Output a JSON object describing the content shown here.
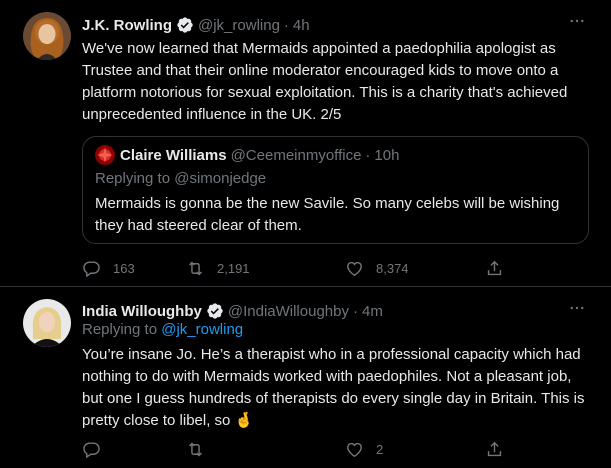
{
  "colors": {
    "background": "#000000",
    "text": "#e7e9ea",
    "secondary": "#71767b",
    "border": "#2f3336",
    "accent": "#1d9bf0"
  },
  "tweet1": {
    "name": "J.K. Rowling",
    "verified": true,
    "handle": "@jk_rowling",
    "dot": "·",
    "time": "4h",
    "text": "We've now learned that Mermaids appointed a paedophilia apologist as Trustee and that their online moderator encouraged kids to move onto a platform notorious for sexual exploitation. This is a charity that's achieved unprecedented influence in the UK. 2/5",
    "quote": {
      "name": "Claire Williams",
      "handle": "@Ceemeinmyoffice",
      "dot": "·",
      "time": "10h",
      "replying": "Replying to @simonjedge",
      "text": "Mermaids is gonna be the new Savile. So many celebs will be wishing they had steered clear of them."
    },
    "actions": {
      "replies": "163",
      "retweets": "2,191",
      "likes": "8,374"
    }
  },
  "tweet2": {
    "name": "India Willoughby",
    "verified": true,
    "handle": "@IndiaWilloughby",
    "dot": "·",
    "time": "4m",
    "replying_prefix": "Replying to ",
    "replying_mention": "@jk_rowling",
    "text": "You’re insane Jo. He’s a therapist who in a professional capacity which had nothing to do with Mermaids worked with paedophiles. Not a pleasant job, but one I guess hundreds of therapists do every single day in Britain. This is pretty close to libel, so 🤞",
    "actions": {
      "replies": "",
      "retweets": "",
      "likes": "2"
    }
  }
}
